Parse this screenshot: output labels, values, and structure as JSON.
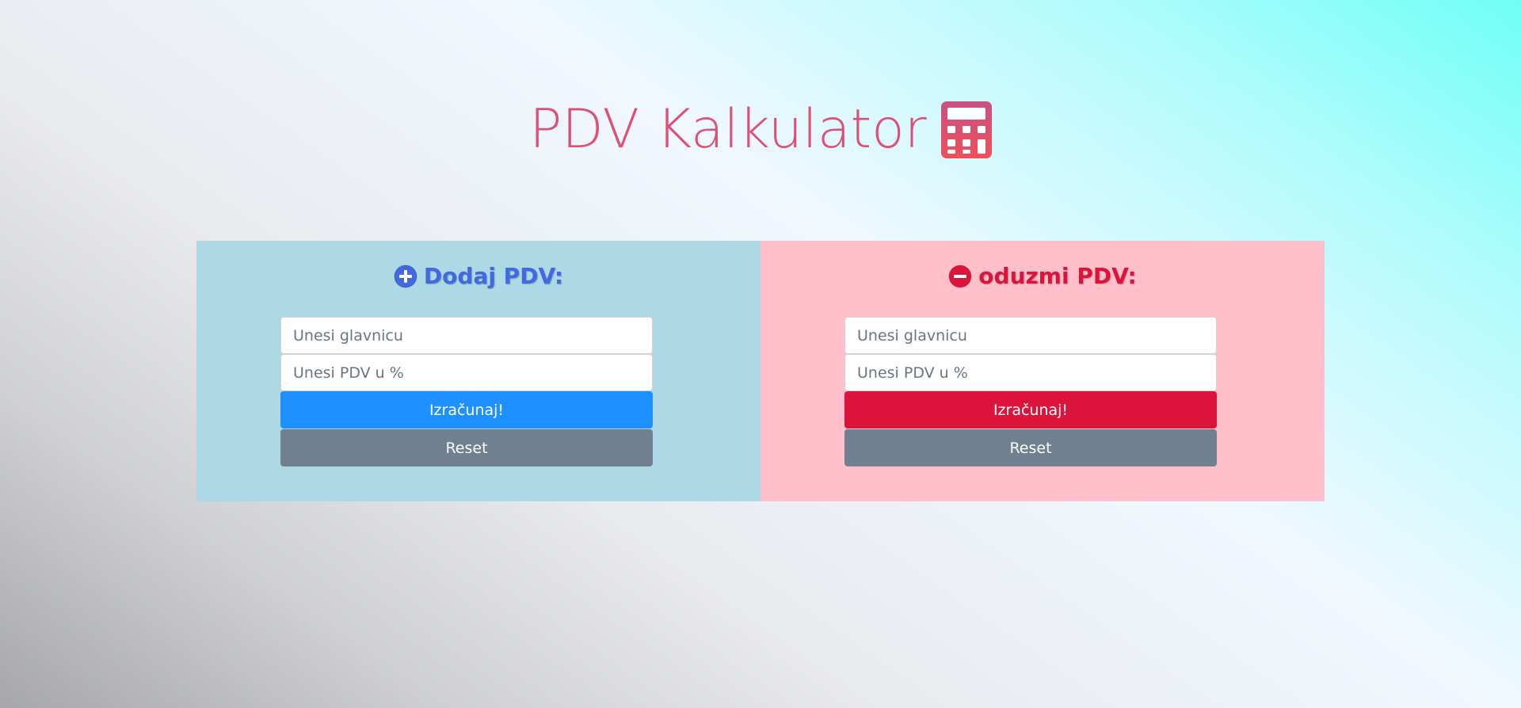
{
  "header": {
    "title": "PDV Kalkulator",
    "icon": "calculator-icon",
    "color": "#de4f73"
  },
  "add_panel": {
    "heading": "Dodaj PDV:",
    "icon": "plus-circle-icon",
    "heading_color": "#4169e1",
    "background": "#add8e6",
    "principal_placeholder": "Unesi glavnicu",
    "vat_placeholder": "Unesi PDV u %",
    "principal_value": "",
    "vat_value": "",
    "calculate_label": "Izračunaj!",
    "calculate_color": "#1e90ff",
    "reset_label": "Reset",
    "reset_color": "#708090"
  },
  "subtract_panel": {
    "heading": "oduzmi PDV:",
    "icon": "minus-circle-icon",
    "heading_color": "#dc143c",
    "background": "#ffc0cb",
    "principal_placeholder": "Unesi glavnicu",
    "vat_placeholder": "Unesi PDV u %",
    "principal_value": "",
    "vat_value": "",
    "calculate_label": "Izračunaj!",
    "calculate_color": "#dc143c",
    "reset_label": "Reset",
    "reset_color": "#708090"
  }
}
